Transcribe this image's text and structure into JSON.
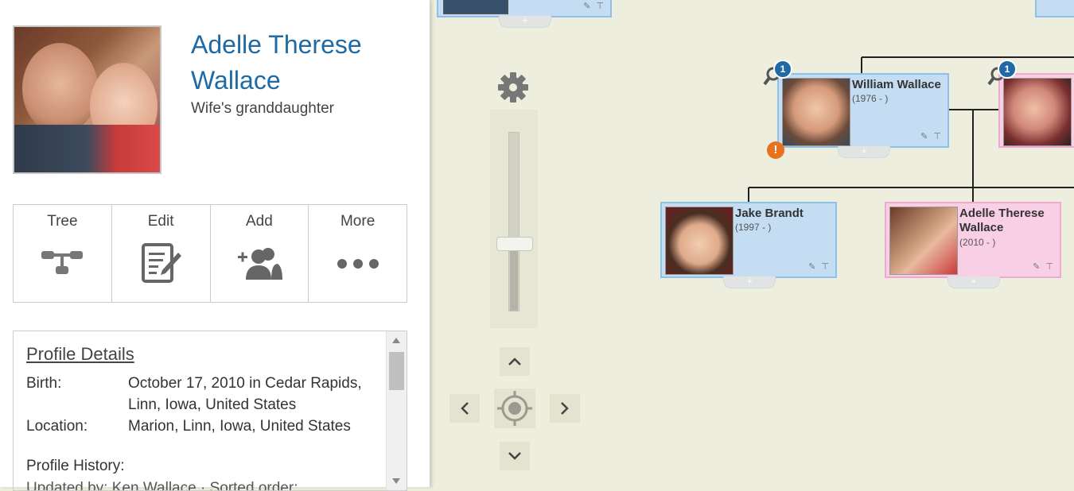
{
  "profile": {
    "name": "Adelle Therese Wallace",
    "relation": "Wife's granddaughter"
  },
  "actions": [
    {
      "label": "Tree",
      "icon": "tree-icon"
    },
    {
      "label": "Edit",
      "icon": "edit-icon"
    },
    {
      "label": "Add",
      "icon": "add-person-icon"
    },
    {
      "label": "More",
      "icon": "more-icon"
    }
  ],
  "details": {
    "title": "Profile Details",
    "birth_label": "Birth:",
    "birth_value": "October 17, 2010 in Cedar Rapids, Linn, Iowa, United States",
    "location_label": "Location:",
    "location_value": "Marion, Linn, Iowa, United States",
    "history_title": "Profile History:",
    "history_line": "Updated by:   Ken Wallace   ·   Sorted order: ..."
  },
  "tree": {
    "cards": [
      {
        "id": "william",
        "name": "William Wallace",
        "dates": "(1976 - )",
        "gender": "male",
        "badge": "1",
        "warning": "!"
      },
      {
        "id": "partner",
        "name": "",
        "dates": "",
        "gender": "female",
        "badge": "1"
      },
      {
        "id": "jake",
        "name": "Jake Brandt",
        "dates": "(1997 - )",
        "gender": "male"
      },
      {
        "id": "adelle",
        "name": "Adelle Therese Wallace",
        "dates": "(2010 - )",
        "gender": "female"
      }
    ],
    "tool_glyphs": "✎ ⊤",
    "plus_glyph": "+"
  },
  "colors": {
    "link_blue": "#1f6aa5",
    "male_card": "#c4ddf2",
    "female_card": "#f8cfe4",
    "canvas_bg": "#eeeede",
    "warning": "#e8731f"
  },
  "zoom": {
    "level": 0.38
  }
}
